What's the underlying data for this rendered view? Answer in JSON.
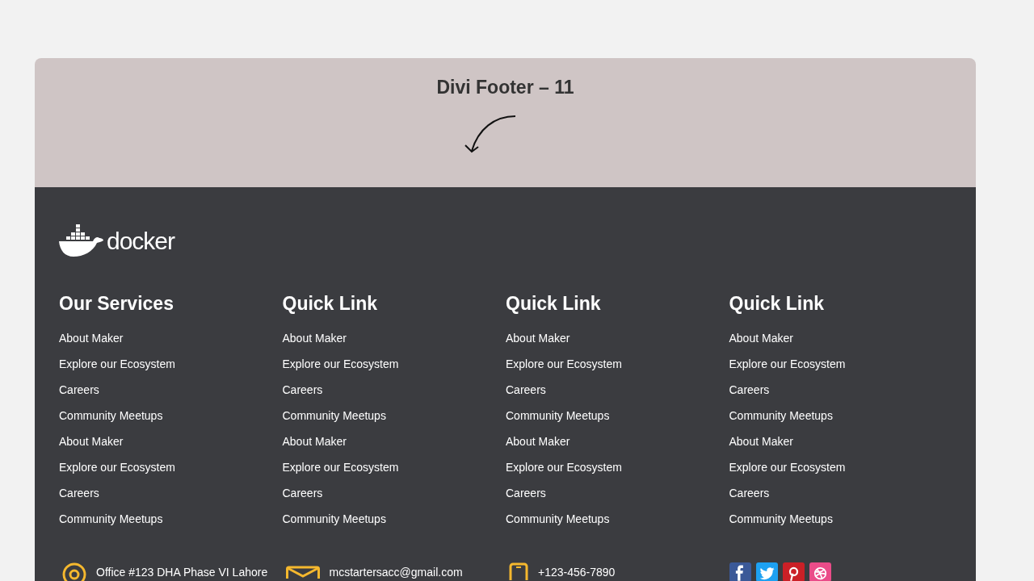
{
  "header": {
    "title": "Divi Footer – 11"
  },
  "footer": {
    "logo_text": "docker",
    "columns": [
      {
        "heading": "Our Services",
        "links": [
          "About Maker",
          "Explore our Ecosystem",
          "Careers",
          "Community Meetups",
          "About Maker",
          "Explore our Ecosystem",
          "Careers",
          "Community Meetups"
        ]
      },
      {
        "heading": "Quick Link",
        "links": [
          "About Maker",
          "Explore our Ecosystem",
          "Careers",
          "Community Meetups",
          "About Maker",
          "Explore our Ecosystem",
          "Careers",
          "Community Meetups"
        ]
      },
      {
        "heading": "Quick Link",
        "links": [
          "About Maker",
          "Explore our Ecosystem",
          "Careers",
          "Community Meetups",
          "About Maker",
          "Explore our Ecosystem",
          "Careers",
          "Community Meetups"
        ]
      },
      {
        "heading": "Quick Link",
        "links": [
          "About Maker",
          "Explore our Ecosystem",
          "Careers",
          "Community Meetups",
          "About Maker",
          "Explore our Ecosystem",
          "Careers",
          "Community Meetups"
        ]
      }
    ],
    "contacts": [
      {
        "kind": "address",
        "text": "Office #123 DHA Phase VI Lahore"
      },
      {
        "kind": "email",
        "text": "mcstartersacc@gmail.com"
      },
      {
        "kind": "phone",
        "text": "+123-456-7890"
      }
    ],
    "social": [
      {
        "kind": "facebook",
        "color": "#3b5998"
      },
      {
        "kind": "twitter",
        "color": "#1da1f2"
      },
      {
        "kind": "pinterest",
        "color": "#cb2027"
      },
      {
        "kind": "dribbble",
        "color": "#ea4c89"
      }
    ]
  }
}
